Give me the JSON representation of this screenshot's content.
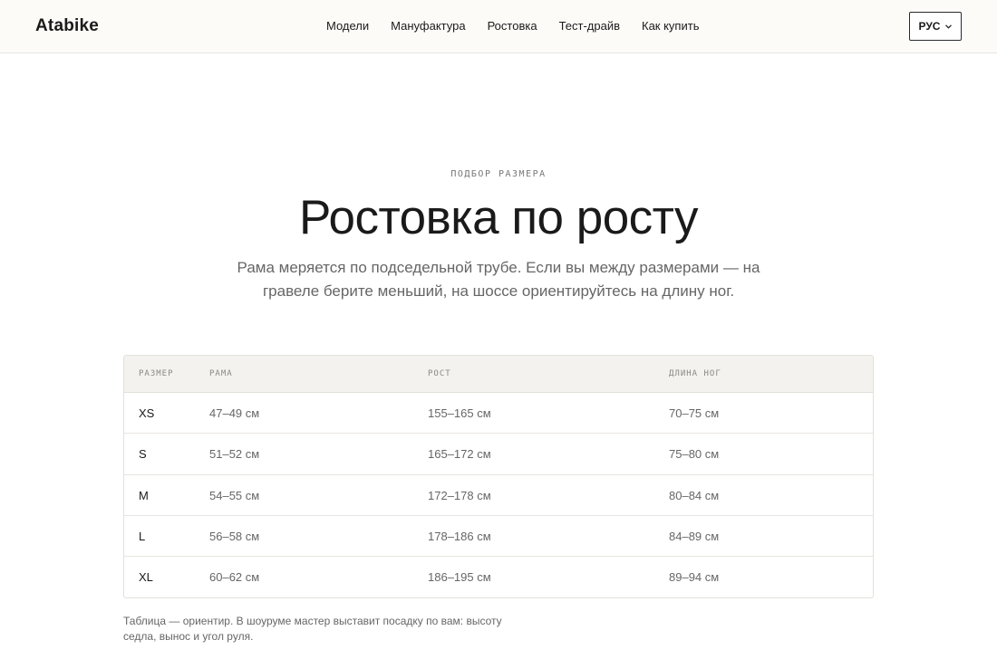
{
  "header": {
    "logo": "Atabike",
    "nav": [
      "Модели",
      "Мануфактура",
      "Ростовка",
      "Тест-драйв",
      "Как купить"
    ],
    "lang": "РУС"
  },
  "hero": {
    "eyebrow": "ПОДБОР РАЗМЕРА",
    "title": "Ростовка по росту",
    "lead": "Рама меряется по подседельной трубе. Если вы между размерами — на гравеле берите меньший, на шоссе ориентируйтесь на длину ног."
  },
  "table": {
    "headers": [
      "РАЗМЕР",
      "РАМА",
      "РОСТ",
      "ДЛИНА НОГ"
    ],
    "rows": [
      [
        "XS",
        "47–49 см",
        "155–165 см",
        "70–75 см"
      ],
      [
        "S",
        "51–52 см",
        "165–172 см",
        "75–80 см"
      ],
      [
        "M",
        "54–55 см",
        "172–178 см",
        "80–84 см"
      ],
      [
        "L",
        "56–58 см",
        "178–186 см",
        "84–89 см"
      ],
      [
        "XL",
        "60–62 см",
        "186–195 см",
        "89–94 см"
      ]
    ]
  },
  "note": "Таблица — ориентир. В шоуруме мастер выставит посадку по вам: высоту седла, вынос и угол руля."
}
